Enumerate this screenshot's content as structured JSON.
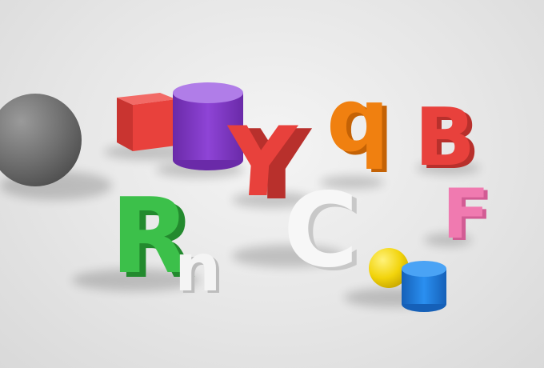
{
  "scene": {
    "background": "#e6e6e6",
    "objects": [
      {
        "name": "gray-sphere",
        "shape": "sphere",
        "color": "#7a7a7a"
      },
      {
        "name": "red-cube",
        "shape": "cube",
        "color": "#e8413c"
      },
      {
        "name": "purple-cylinder",
        "shape": "cylinder",
        "color": "#8e44d6"
      },
      {
        "name": "letter-Y",
        "text": "Y",
        "color": "#e8413c"
      },
      {
        "name": "letter-q",
        "text": "q",
        "color": "#f08010"
      },
      {
        "name": "letter-B",
        "text": "B",
        "color": "#e8413c"
      },
      {
        "name": "letter-F",
        "text": "F",
        "color": "#f07ab0"
      },
      {
        "name": "letter-R",
        "text": "R",
        "color": "#3cc04a"
      },
      {
        "name": "letter-n",
        "text": "n",
        "color": "#f4f4f4"
      },
      {
        "name": "letter-C",
        "text": "C",
        "color": "#f7f7f7"
      },
      {
        "name": "yellow-sphere",
        "shape": "sphere",
        "color": "#f2d40c"
      },
      {
        "name": "blue-cylinder",
        "shape": "cylinder",
        "color": "#1f7fe0"
      }
    ]
  }
}
